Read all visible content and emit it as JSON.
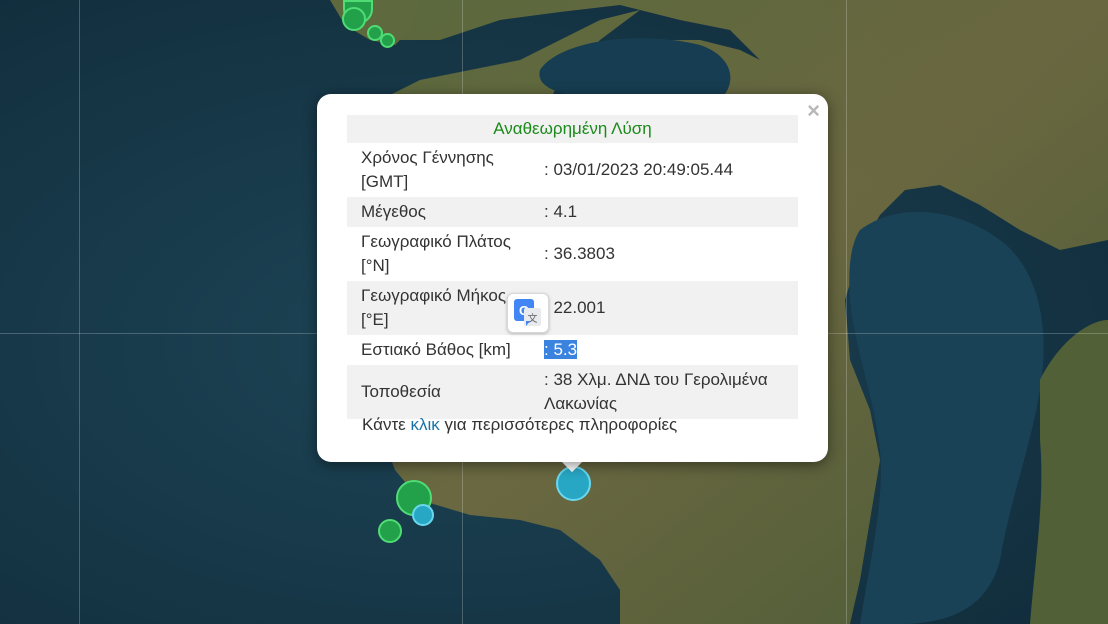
{
  "popup": {
    "title": "Αναθεωρημένη Λύση",
    "close_symbol": "×",
    "rows": [
      {
        "label": "Χρόνος Γέννησης [GMT]",
        "value": ": 03/01/2023 20:49:05.44"
      },
      {
        "label": "Μέγεθος",
        "value": ": 4.1"
      },
      {
        "label": "Γεωγραφικό Πλάτος [°N]",
        "value": ": 36.3803"
      },
      {
        "label": "Γεωγραφικό Μήκος [°E]",
        "value": ": 22.001"
      },
      {
        "label": "Εστιακό Βάθος [km]",
        "value": ": 5.3"
      },
      {
        "label": "Τοποθεσία",
        "value": ": 38 Χλμ. ΔΝΔ του Γερολιμένα Λακωνίας"
      }
    ],
    "more_prefix": "Κάντε ",
    "more_link": "κλικ",
    "more_suffix": " για περισσότερες πληροφορίες"
  },
  "translate_icon": "google-translate-icon",
  "colors": {
    "title_green": "#1b8a1b",
    "link_blue": "#1a73a8",
    "selection_blue": "#3a84e0",
    "quake_green": "#22a04a",
    "quake_cyan": "#28a7c4"
  }
}
